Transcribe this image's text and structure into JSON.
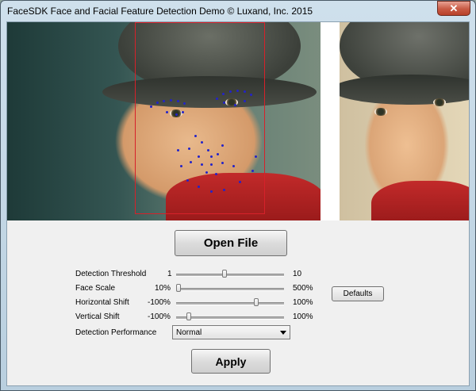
{
  "window": {
    "title": "FaceSDK Face and Facial Feature Detection Demo © Luxand, Inc. 2015",
    "close_glyph": "✕"
  },
  "main": {
    "open_file_label": "Open File",
    "apply_label": "Apply",
    "defaults_label": "Defaults"
  },
  "sliders": [
    {
      "label": "Detection Threshold",
      "min_label": "1",
      "max_label": "10",
      "value": 5
    },
    {
      "label": "Face Scale",
      "min_label": "10%",
      "max_label": "500%",
      "value": 10
    },
    {
      "label": "Horizontal Shift",
      "min_label": "-100%",
      "max_label": "100%",
      "value": 50
    },
    {
      "label": "Vertical Shift",
      "min_label": "-100%",
      "max_label": "100%",
      "value": -80
    }
  ],
  "performance": {
    "label": "Detection Performance",
    "selected": "Normal"
  },
  "colors": {
    "face_box": "#d6212a",
    "feature_points": "#2323c9"
  }
}
